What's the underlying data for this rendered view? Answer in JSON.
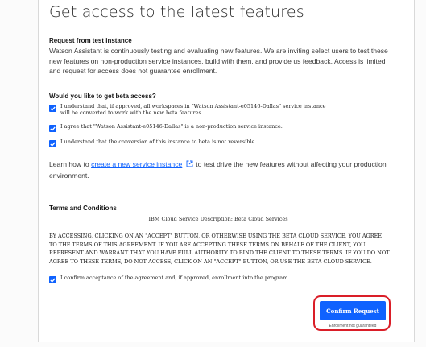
{
  "page": {
    "title": "Get access to the latest features"
  },
  "request": {
    "heading": "Request from test instance",
    "body": "Watson Assistant is continuously testing and evaluating new features. We are inviting select users to test these new features on non-production service instances, build with them, and provide us feedback. Access is limited and request for access does not guarantee enrollment."
  },
  "beta": {
    "heading": "Would you like to get beta access?",
    "checkboxes": [
      {
        "label": "I understand that, if approved, all workspaces in \"Watson Assistant-e05146-Dallas\" service instance will be converted to work with the new beta features.",
        "checked": true
      },
      {
        "label": "I agree that \"Watson Assistant-e05146-Dallas\" is a non-production service instance.",
        "checked": true
      },
      {
        "label": "I understand that the conversion of this instance to beta is not reversible.",
        "checked": true
      }
    ]
  },
  "learn": {
    "prefix": "Learn how to ",
    "link_text": "create a new service instance",
    "link_icon": "launch-icon",
    "suffix": "to test drive the new features without affecting your production environment."
  },
  "terms": {
    "heading": "Terms and Conditions",
    "subtitle": "IBM Cloud Service Description: Beta Cloud Services",
    "body": "BY ACCESSING, CLICKING ON AN \"ACCEPT\" BUTTON, OR OTHERWISE USING THE BETA CLOUD SERVICE, YOU AGREE TO THE TERMS OF THIS AGREEMENT. IF YOU ARE ACCEPTING THESE TERMS ON BEHALF OF THE CLIENT, YOU REPRESENT AND WARRANT THAT YOU HAVE FULL AUTHORITY TO BIND THE CLIENT TO THESE TERMS. IF YOU DO NOT AGREE TO THESE TERMS, DO NOT ACCESS, CLICK ON AN \"ACCEPT\" BUTTON, OR USE THE BETA CLOUD SERVICE.",
    "accept_label": "I confirm acceptance of the agreement and, if approved, enrollment into the program.",
    "accept_checked": true
  },
  "actions": {
    "confirm_label": "Confirm Request",
    "note": "Enrollment not guaranteed"
  },
  "colors": {
    "accent": "#0f62fe",
    "highlight": "#da1e28"
  }
}
